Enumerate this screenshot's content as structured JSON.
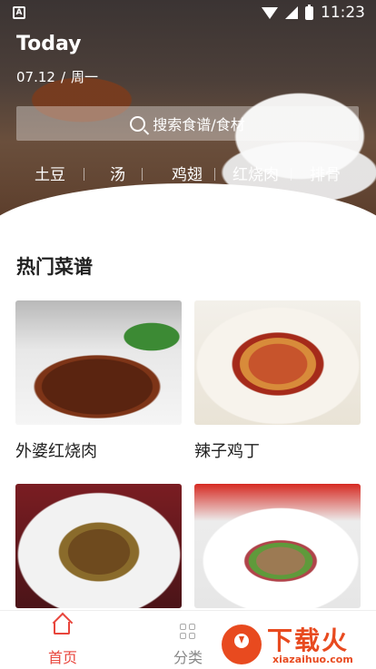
{
  "status_bar": {
    "time": "11:23"
  },
  "header": {
    "title": "Today",
    "date": "07.12",
    "weekday": "周一"
  },
  "search": {
    "placeholder": "搜索食谱/食材"
  },
  "tags": [
    "土豆",
    "汤",
    "鸡翅",
    "红烧肉",
    "排骨"
  ],
  "section": {
    "title": "热门菜谱"
  },
  "recipes": [
    {
      "name": "外婆红烧肉"
    },
    {
      "name": "辣子鸡丁"
    },
    {
      "name": ""
    },
    {
      "name": ""
    }
  ],
  "bottom_nav": [
    {
      "label": "首页",
      "icon": "home-icon",
      "active": true,
      "color": "#e8453c"
    },
    {
      "label": "分类",
      "icon": "grid-icon",
      "active": false,
      "color": "#888888"
    }
  ],
  "watermark": {
    "title": "下载火",
    "url": "xiazaihuo.com"
  }
}
